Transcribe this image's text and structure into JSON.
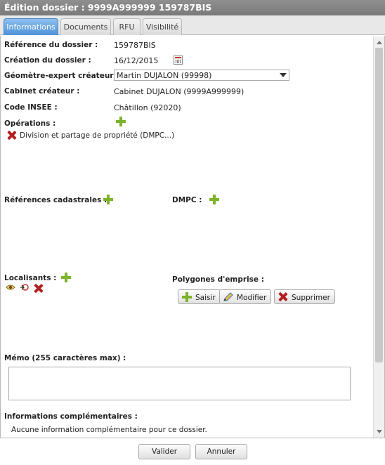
{
  "window": {
    "title": "Édition dossier : 9999A999999 159787BIS"
  },
  "tabs": [
    {
      "label": "Informations",
      "active": true
    },
    {
      "label": "Documents",
      "active": false
    },
    {
      "label": "RFU",
      "active": false
    },
    {
      "label": "Visibilité",
      "active": false
    }
  ],
  "form": {
    "reference": {
      "label": "Référence du dossier  :",
      "value": "159787BIS"
    },
    "creation": {
      "label": "Création du dossier  :",
      "value": "16/12/2015"
    },
    "geometre": {
      "label": "Géomètre-expert créateur :",
      "value": "Martin DUJALON (99998)"
    },
    "cabinet": {
      "label": "Cabinet créateur :",
      "value": "Cabinet DUJALON (9999A999999)"
    },
    "insee": {
      "label": "Code INSEE :",
      "value": "Châtillon (92020)"
    },
    "operations": {
      "label": "Opérations :",
      "items": [
        "Division et partage de propriété (DMPC...)"
      ]
    },
    "references_cadastrales": {
      "label": "Références cadastrales :"
    },
    "dmpc": {
      "label": "DMPC :"
    },
    "localisants": {
      "label": "Localisants :"
    },
    "polygones": {
      "label": "Polygones d'emprise :",
      "buttons": {
        "saisir": "Saisir",
        "modifier": "Modifier",
        "supprimer": "Supprimer"
      }
    },
    "memo": {
      "label": "Mémo (255 caractères max) :",
      "value": ""
    },
    "infos_comp": {
      "label": "Informations complémentaires :",
      "text": "Aucune information complémentaire pour ce dossier."
    }
  },
  "footer": {
    "valider": "Valider",
    "annuler": "Annuler"
  },
  "colors": {
    "tab_active": "#4f92d6",
    "titlebar": "#858585",
    "plus": "#7cb32a",
    "delete": "#b41e1e"
  }
}
